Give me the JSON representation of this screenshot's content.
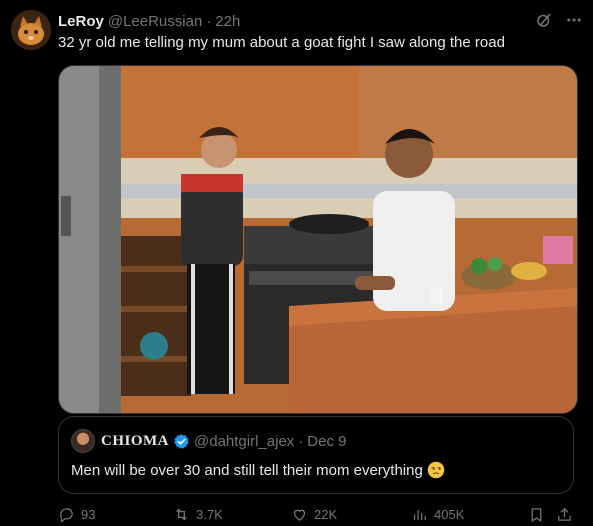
{
  "tweet": {
    "author_name": "LeRoy",
    "author_handle": "@LeeRussian",
    "separator": "·",
    "time": "22h",
    "text": "32 yr old me telling my mum about a goat fight I saw along the road"
  },
  "quote": {
    "author_name": "CHIOMA",
    "author_handle": "@dahtgirl_ajex",
    "separator": "·",
    "date": "Dec 9",
    "text": "Men will be over 30 and still tell their mom everything",
    "emoji": "😒"
  },
  "actions": {
    "replies": "93",
    "reposts": "3.7K",
    "likes": "22K",
    "views": "405K"
  },
  "icons": {
    "header": [
      "grok-icon",
      "more-icon"
    ],
    "actions": [
      "reply-icon",
      "repost-icon",
      "like-icon",
      "views-icon",
      "bookmark-icon",
      "share-icon"
    ]
  },
  "colors": {
    "background": "#000000",
    "text": "#e7e9ea",
    "muted": "#71767b",
    "border": "#2f3336",
    "verified": "#1d9bf0"
  }
}
